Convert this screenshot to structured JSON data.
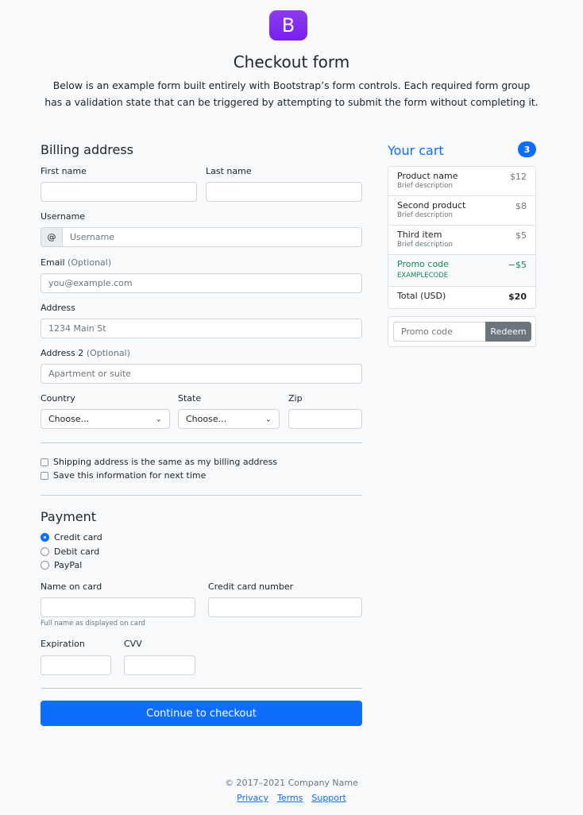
{
  "header": {
    "logo_letter": "B",
    "title": "Checkout form",
    "lead": "Below is an example form built entirely with Bootstrap’s form controls. Each required form group has a validation state that can be triggered by attempting to submit the form without completing it."
  },
  "billing": {
    "heading": "Billing address",
    "first_name_label": "First name",
    "last_name_label": "Last name",
    "username_label": "Username",
    "username_prefix": "@",
    "username_placeholder": "Username",
    "email_label": "Email",
    "email_optional": "(Optional)",
    "email_placeholder": "you@example.com",
    "address_label": "Address",
    "address_placeholder": "1234 Main St",
    "address2_label": "Address 2",
    "address2_optional": "(Optional)",
    "address2_placeholder": "Apartment or suite",
    "country_label": "Country",
    "country_value": "Choose...",
    "state_label": "State",
    "state_value": "Choose...",
    "zip_label": "Zip",
    "same_address_label": "Shipping address is the same as my billing address",
    "save_info_label": "Save this information for next time"
  },
  "payment": {
    "heading": "Payment",
    "options": [
      "Credit card",
      "Debit card",
      "PayPal"
    ],
    "selected": "Credit card",
    "name_on_card_label": "Name on card",
    "name_on_card_help": "Full name as displayed on card",
    "card_number_label": "Credit card number",
    "expiration_label": "Expiration",
    "cvv_label": "CVV",
    "submit_label": "Continue to checkout"
  },
  "cart": {
    "title": "Your cart",
    "count": "3",
    "items": [
      {
        "name": "Product name",
        "desc": "Brief description",
        "price": "$12"
      },
      {
        "name": "Second product",
        "desc": "Brief description",
        "price": "$8"
      },
      {
        "name": "Third item",
        "desc": "Brief description",
        "price": "$5"
      }
    ],
    "promo": {
      "name": "Promo code",
      "code": "EXAMPLECODE",
      "amount": "−$5"
    },
    "total_label": "Total (USD)",
    "total_value": "$20",
    "promo_placeholder": "Promo code",
    "redeem_label": "Redeem"
  },
  "footer": {
    "copyright": "© 2017–2021 Company Name",
    "links": [
      "Privacy",
      "Terms",
      "Support"
    ]
  },
  "colors": {
    "primary": "#0d6efd",
    "brand": "#7952b3",
    "success": "#198754",
    "secondary": "#6c757d"
  }
}
